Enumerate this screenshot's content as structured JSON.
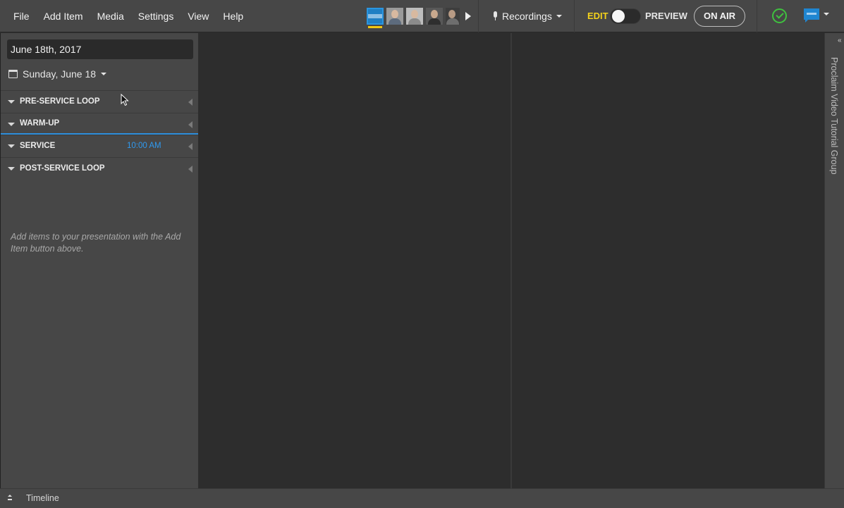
{
  "menu": {
    "items": [
      "File",
      "Add Item",
      "Media",
      "Settings",
      "View",
      "Help"
    ]
  },
  "toolbar": {
    "recordings_label": "Recordings",
    "edit_label": "EDIT",
    "preview_label": "PREVIEW",
    "onair_label": "ON AIR",
    "mode": "edit"
  },
  "sidebar": {
    "date_field_value": "June 18th, 2017",
    "date_picker_label": "Sunday, June 18",
    "sections": [
      {
        "title": "PRE-SERVICE LOOP",
        "time": ""
      },
      {
        "title": "WARM-UP",
        "time": ""
      },
      {
        "title": "SERVICE",
        "time": "10:00 AM"
      },
      {
        "title": "POST-SERVICE LOOP",
        "time": ""
      }
    ],
    "empty_hint": "Add items to your presentation with the Add Item button above."
  },
  "rail": {
    "label": "Proclaim Video Tutorial Group"
  },
  "bottom": {
    "timeline_label": "Timeline"
  },
  "colors": {
    "accent_blue": "#2d8fdc",
    "edit_yellow": "#f4d21b",
    "status_green": "#3fc23f"
  }
}
